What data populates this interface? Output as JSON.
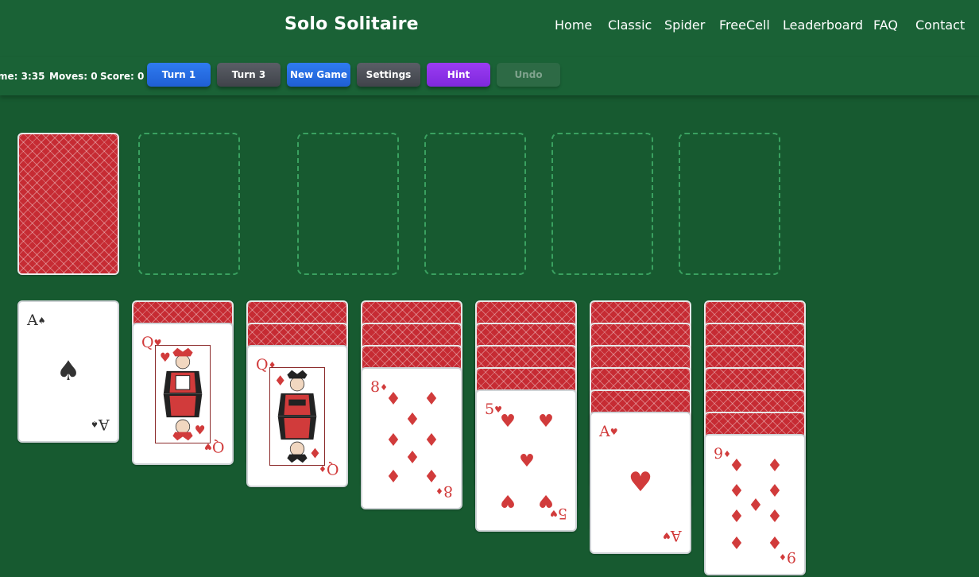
{
  "header": {
    "title": "Solo Solitaire",
    "nav": [
      "Home",
      "Classic",
      "Spider",
      "FreeCell",
      "Leaderboard",
      "FAQ",
      "Contact"
    ]
  },
  "toolbar": {
    "time": "me: 3:35",
    "moves": "Moves: 0",
    "score": "Score: 0",
    "buttons": {
      "turn1": "Turn 1",
      "turn3": "Turn 3",
      "new_game": "New Game",
      "settings": "Settings",
      "hint": "Hint",
      "undo": "Undo"
    }
  },
  "colors": {
    "felt": "#175a30",
    "header": "#1a6236",
    "card_back": "#c62b33",
    "red_suit": "#d13b3b",
    "blue_button": "#2f7bf0",
    "purple_button": "#9a3cf2"
  },
  "board": {
    "stock": "face-down",
    "waste": "empty",
    "foundations": [
      "empty",
      "empty",
      "empty",
      "empty"
    ],
    "tableau": [
      {
        "hidden": 0,
        "top": {
          "rank": "A",
          "suit": "♠",
          "color": "black"
        }
      },
      {
        "hidden": 1,
        "top": {
          "rank": "Q",
          "suit": "♥",
          "color": "red"
        }
      },
      {
        "hidden": 2,
        "top": {
          "rank": "Q",
          "suit": "♦",
          "color": "red"
        }
      },
      {
        "hidden": 3,
        "top": {
          "rank": "8",
          "suit": "♦",
          "color": "red"
        }
      },
      {
        "hidden": 4,
        "top": {
          "rank": "5",
          "suit": "♥",
          "color": "red"
        }
      },
      {
        "hidden": 5,
        "top": {
          "rank": "A",
          "suit": "♥",
          "color": "red"
        }
      },
      {
        "hidden": 6,
        "top": {
          "rank": "9",
          "suit": "♦",
          "color": "red"
        }
      }
    ]
  }
}
